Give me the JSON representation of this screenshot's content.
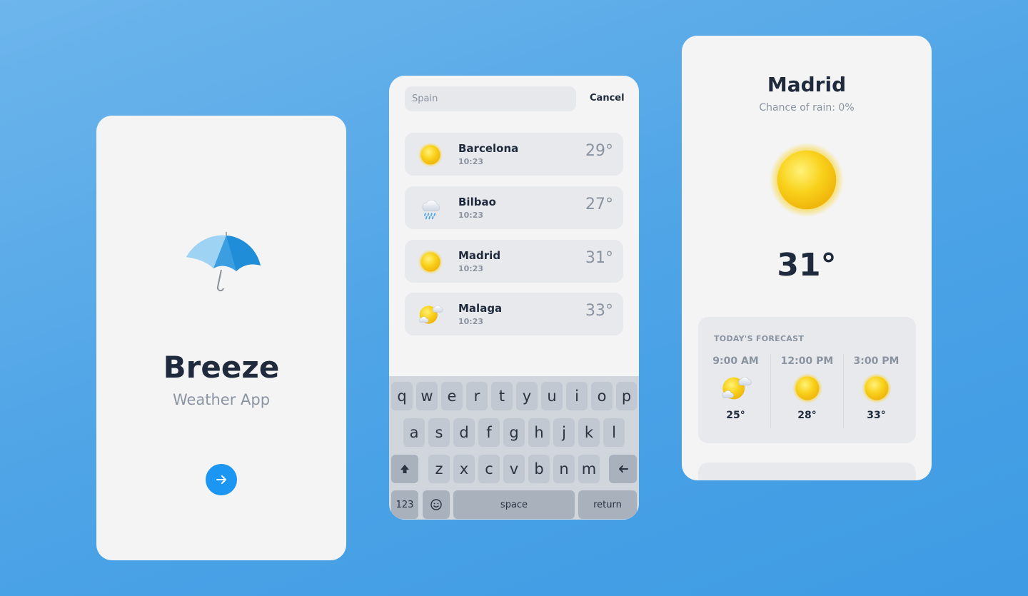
{
  "splash": {
    "brand": "Breeze",
    "tagline": "Weather App",
    "next_icon": "arrow-right-icon"
  },
  "search": {
    "query": "Spain",
    "cancel_label": "Cancel",
    "results": [
      {
        "name": "Barcelona",
        "time": "10:23",
        "temp": "29°",
        "icon": "sun-icon"
      },
      {
        "name": "Bilbao",
        "time": "10:23",
        "temp": "27°",
        "icon": "rain-cloud-icon"
      },
      {
        "name": "Madrid",
        "time": "10:23",
        "temp": "31°",
        "icon": "sun-icon"
      },
      {
        "name": "Malaga",
        "time": "10:23",
        "temp": "33°",
        "icon": "partly-cloudy-icon"
      }
    ],
    "keyboard": {
      "row1": [
        "q",
        "w",
        "e",
        "r",
        "t",
        "y",
        "u",
        "i",
        "o",
        "p"
      ],
      "row2": [
        "a",
        "s",
        "d",
        "f",
        "g",
        "h",
        "j",
        "k",
        "l"
      ],
      "row3": [
        "z",
        "x",
        "c",
        "v",
        "b",
        "n",
        "m"
      ],
      "numbers_label": "123",
      "space_label": "space",
      "return_label": "return"
    }
  },
  "detail": {
    "city": "Madrid",
    "rain_chance": "Chance of rain: 0%",
    "temperature": "31°",
    "forecast_title": "TODAY'S FORECAST",
    "forecast": [
      {
        "time": "9:00 AM",
        "temp": "25°",
        "icon": "partly-cloudy-icon"
      },
      {
        "time": "12:00 PM",
        "temp": "28°",
        "icon": "sun-icon"
      },
      {
        "time": "3:00 PM",
        "temp": "33°",
        "icon": "sun-icon"
      }
    ]
  },
  "colors": {
    "background": "#4ea4e6",
    "card": "#f4f4f5",
    "accent": "#1b96f3",
    "text_dark": "#1f2b3d",
    "text_muted": "#8a93a0",
    "sun": "#f7cf1a"
  }
}
